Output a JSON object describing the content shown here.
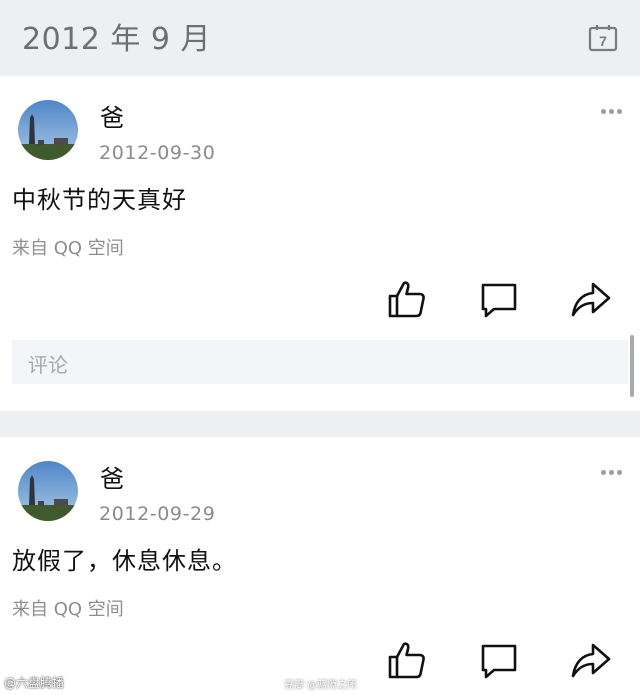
{
  "header": {
    "month": "2012 年 9 月",
    "calendar_day": "7"
  },
  "posts": [
    {
      "author": "爸",
      "date": "2012-09-30",
      "content": "中秋节的天真好",
      "source": "来自 QQ 空间",
      "comment_placeholder": "评论"
    },
    {
      "author": "爸",
      "date": "2012-09-29",
      "content": "放假了，休息休息。",
      "source": "来自 QQ 空间"
    }
  ],
  "watermarks": {
    "left": "@六盘腾播",
    "middle": "豆瓣 @蓝隙之所"
  },
  "colors": {
    "background": "#eeeff3",
    "card": "#ffffff",
    "muted_text": "#8a8b8f"
  },
  "icons": [
    "calendar-icon",
    "more-icon",
    "like-icon",
    "comment-icon",
    "share-icon"
  ]
}
